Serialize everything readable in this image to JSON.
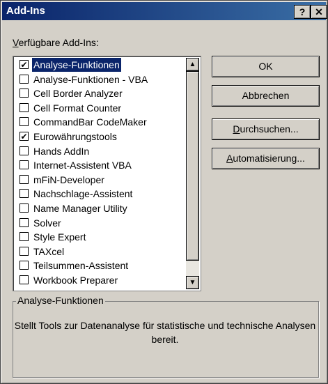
{
  "window": {
    "title": "Add-Ins",
    "help_label": "?",
    "close_label": "✕"
  },
  "list_label_prefix": "V",
  "list_label_rest": "erfügbare Add-Ins:",
  "addins": [
    {
      "label": "Analyse-Funktionen",
      "checked": true,
      "selected": true
    },
    {
      "label": "Analyse-Funktionen - VBA",
      "checked": false
    },
    {
      "label": "Cell Border Analyzer",
      "checked": false
    },
    {
      "label": "Cell Format Counter",
      "checked": false
    },
    {
      "label": "CommandBar CodeMaker",
      "checked": false
    },
    {
      "label": "Eurowährungstools",
      "checked": true
    },
    {
      "label": "Hands AddIn",
      "checked": false
    },
    {
      "label": "Internet-Assistent VBA",
      "checked": false
    },
    {
      "label": "mFiN-Developer",
      "checked": false
    },
    {
      "label": "Nachschlage-Assistent",
      "checked": false
    },
    {
      "label": "Name Manager Utility",
      "checked": false
    },
    {
      "label": "Solver",
      "checked": false
    },
    {
      "label": "Style Expert",
      "checked": false
    },
    {
      "label": "TAXcel",
      "checked": false
    },
    {
      "label": "Teilsummen-Assistent",
      "checked": false
    },
    {
      "label": "Workbook Preparer",
      "checked": false
    }
  ],
  "checkmark": "✔",
  "scroll": {
    "up": "▲",
    "down": "▼"
  },
  "buttons": {
    "ok": "OK",
    "cancel": "Abbrechen",
    "browse_prefix": "D",
    "browse_rest": "urchsuchen...",
    "automation_prefix": "A",
    "automation_rest": "utomatisierung..."
  },
  "description": {
    "title": "Analyse-Funktionen",
    "text": "Stellt Tools zur Datenanalyse für statistische und technische Analysen bereit."
  }
}
